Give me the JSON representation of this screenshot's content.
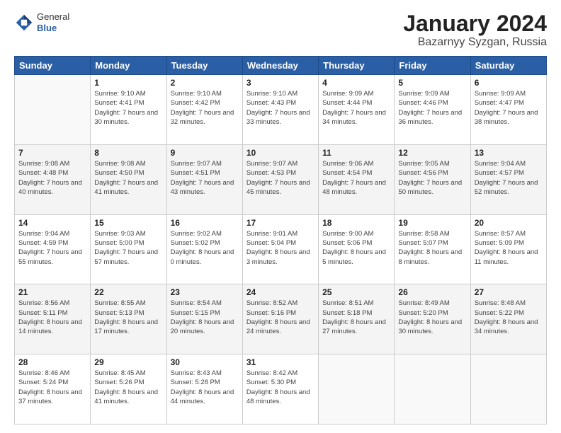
{
  "header": {
    "logo_line1": "General",
    "logo_line2": "Blue",
    "title": "January 2024",
    "subtitle": "Bazarnyy Syzgan, Russia"
  },
  "calendar": {
    "headers": [
      "Sunday",
      "Monday",
      "Tuesday",
      "Wednesday",
      "Thursday",
      "Friday",
      "Saturday"
    ],
    "weeks": [
      [
        {
          "day": "",
          "sunrise": "",
          "sunset": "",
          "daylight": ""
        },
        {
          "day": "1",
          "sunrise": "Sunrise: 9:10 AM",
          "sunset": "Sunset: 4:41 PM",
          "daylight": "Daylight: 7 hours and 30 minutes."
        },
        {
          "day": "2",
          "sunrise": "Sunrise: 9:10 AM",
          "sunset": "Sunset: 4:42 PM",
          "daylight": "Daylight: 7 hours and 32 minutes."
        },
        {
          "day": "3",
          "sunrise": "Sunrise: 9:10 AM",
          "sunset": "Sunset: 4:43 PM",
          "daylight": "Daylight: 7 hours and 33 minutes."
        },
        {
          "day": "4",
          "sunrise": "Sunrise: 9:09 AM",
          "sunset": "Sunset: 4:44 PM",
          "daylight": "Daylight: 7 hours and 34 minutes."
        },
        {
          "day": "5",
          "sunrise": "Sunrise: 9:09 AM",
          "sunset": "Sunset: 4:46 PM",
          "daylight": "Daylight: 7 hours and 36 minutes."
        },
        {
          "day": "6",
          "sunrise": "Sunrise: 9:09 AM",
          "sunset": "Sunset: 4:47 PM",
          "daylight": "Daylight: 7 hours and 38 minutes."
        }
      ],
      [
        {
          "day": "7",
          "sunrise": "Sunrise: 9:08 AM",
          "sunset": "Sunset: 4:48 PM",
          "daylight": "Daylight: 7 hours and 40 minutes."
        },
        {
          "day": "8",
          "sunrise": "Sunrise: 9:08 AM",
          "sunset": "Sunset: 4:50 PM",
          "daylight": "Daylight: 7 hours and 41 minutes."
        },
        {
          "day": "9",
          "sunrise": "Sunrise: 9:07 AM",
          "sunset": "Sunset: 4:51 PM",
          "daylight": "Daylight: 7 hours and 43 minutes."
        },
        {
          "day": "10",
          "sunrise": "Sunrise: 9:07 AM",
          "sunset": "Sunset: 4:53 PM",
          "daylight": "Daylight: 7 hours and 45 minutes."
        },
        {
          "day": "11",
          "sunrise": "Sunrise: 9:06 AM",
          "sunset": "Sunset: 4:54 PM",
          "daylight": "Daylight: 7 hours and 48 minutes."
        },
        {
          "day": "12",
          "sunrise": "Sunrise: 9:05 AM",
          "sunset": "Sunset: 4:56 PM",
          "daylight": "Daylight: 7 hours and 50 minutes."
        },
        {
          "day": "13",
          "sunrise": "Sunrise: 9:04 AM",
          "sunset": "Sunset: 4:57 PM",
          "daylight": "Daylight: 7 hours and 52 minutes."
        }
      ],
      [
        {
          "day": "14",
          "sunrise": "Sunrise: 9:04 AM",
          "sunset": "Sunset: 4:59 PM",
          "daylight": "Daylight: 7 hours and 55 minutes."
        },
        {
          "day": "15",
          "sunrise": "Sunrise: 9:03 AM",
          "sunset": "Sunset: 5:00 PM",
          "daylight": "Daylight: 7 hours and 57 minutes."
        },
        {
          "day": "16",
          "sunrise": "Sunrise: 9:02 AM",
          "sunset": "Sunset: 5:02 PM",
          "daylight": "Daylight: 8 hours and 0 minutes."
        },
        {
          "day": "17",
          "sunrise": "Sunrise: 9:01 AM",
          "sunset": "Sunset: 5:04 PM",
          "daylight": "Daylight: 8 hours and 3 minutes."
        },
        {
          "day": "18",
          "sunrise": "Sunrise: 9:00 AM",
          "sunset": "Sunset: 5:06 PM",
          "daylight": "Daylight: 8 hours and 5 minutes."
        },
        {
          "day": "19",
          "sunrise": "Sunrise: 8:58 AM",
          "sunset": "Sunset: 5:07 PM",
          "daylight": "Daylight: 8 hours and 8 minutes."
        },
        {
          "day": "20",
          "sunrise": "Sunrise: 8:57 AM",
          "sunset": "Sunset: 5:09 PM",
          "daylight": "Daylight: 8 hours and 11 minutes."
        }
      ],
      [
        {
          "day": "21",
          "sunrise": "Sunrise: 8:56 AM",
          "sunset": "Sunset: 5:11 PM",
          "daylight": "Daylight: 8 hours and 14 minutes."
        },
        {
          "day": "22",
          "sunrise": "Sunrise: 8:55 AM",
          "sunset": "Sunset: 5:13 PM",
          "daylight": "Daylight: 8 hours and 17 minutes."
        },
        {
          "day": "23",
          "sunrise": "Sunrise: 8:54 AM",
          "sunset": "Sunset: 5:15 PM",
          "daylight": "Daylight: 8 hours and 20 minutes."
        },
        {
          "day": "24",
          "sunrise": "Sunrise: 8:52 AM",
          "sunset": "Sunset: 5:16 PM",
          "daylight": "Daylight: 8 hours and 24 minutes."
        },
        {
          "day": "25",
          "sunrise": "Sunrise: 8:51 AM",
          "sunset": "Sunset: 5:18 PM",
          "daylight": "Daylight: 8 hours and 27 minutes."
        },
        {
          "day": "26",
          "sunrise": "Sunrise: 8:49 AM",
          "sunset": "Sunset: 5:20 PM",
          "daylight": "Daylight: 8 hours and 30 minutes."
        },
        {
          "day": "27",
          "sunrise": "Sunrise: 8:48 AM",
          "sunset": "Sunset: 5:22 PM",
          "daylight": "Daylight: 8 hours and 34 minutes."
        }
      ],
      [
        {
          "day": "28",
          "sunrise": "Sunrise: 8:46 AM",
          "sunset": "Sunset: 5:24 PM",
          "daylight": "Daylight: 8 hours and 37 minutes."
        },
        {
          "day": "29",
          "sunrise": "Sunrise: 8:45 AM",
          "sunset": "Sunset: 5:26 PM",
          "daylight": "Daylight: 8 hours and 41 minutes."
        },
        {
          "day": "30",
          "sunrise": "Sunrise: 8:43 AM",
          "sunset": "Sunset: 5:28 PM",
          "daylight": "Daylight: 8 hours and 44 minutes."
        },
        {
          "day": "31",
          "sunrise": "Sunrise: 8:42 AM",
          "sunset": "Sunset: 5:30 PM",
          "daylight": "Daylight: 8 hours and 48 minutes."
        },
        {
          "day": "",
          "sunrise": "",
          "sunset": "",
          "daylight": ""
        },
        {
          "day": "",
          "sunrise": "",
          "sunset": "",
          "daylight": ""
        },
        {
          "day": "",
          "sunrise": "",
          "sunset": "",
          "daylight": ""
        }
      ]
    ]
  }
}
